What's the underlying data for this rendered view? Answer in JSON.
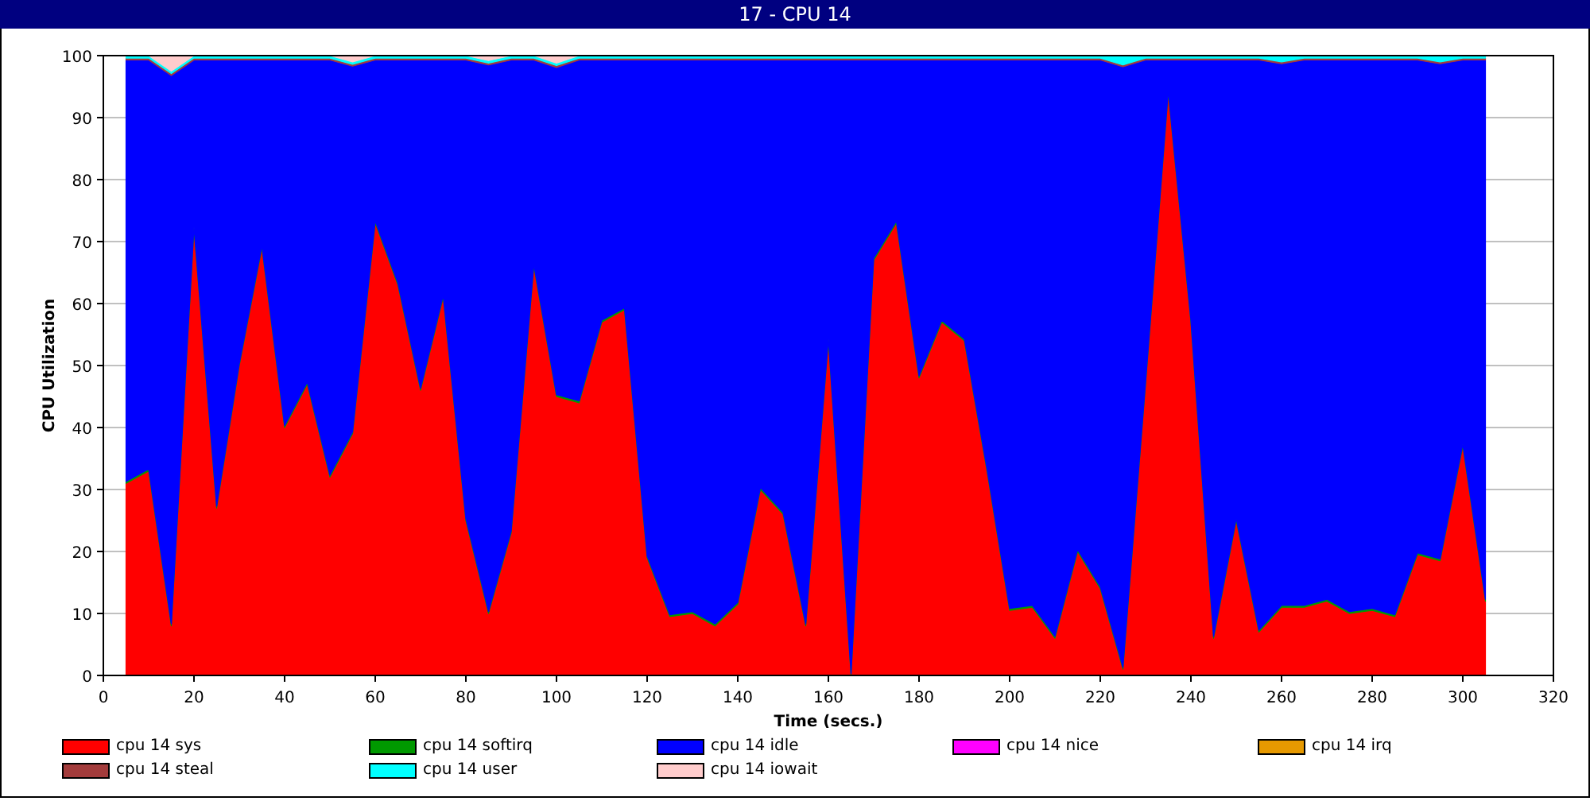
{
  "window": {
    "title": "17 - CPU 14"
  },
  "chart": {
    "chart_data": {
      "type": "area",
      "stacked": true,
      "grid": true,
      "xlabel": "Time (secs.)",
      "ylabel": "CPU Utilization",
      "xlim": [
        0,
        320
      ],
      "ylim": [
        0,
        100
      ],
      "xticks": [
        0,
        20,
        40,
        60,
        80,
        100,
        120,
        140,
        160,
        180,
        200,
        220,
        240,
        260,
        280,
        300,
        320
      ],
      "yticks": [
        0,
        10,
        20,
        30,
        40,
        50,
        60,
        70,
        80,
        90,
        100
      ],
      "x": [
        5,
        10,
        15,
        20,
        25,
        30,
        35,
        40,
        45,
        50,
        55,
        60,
        65,
        70,
        75,
        80,
        85,
        90,
        95,
        100,
        105,
        110,
        115,
        120,
        125,
        130,
        135,
        140,
        145,
        150,
        155,
        160,
        165,
        170,
        175,
        180,
        185,
        190,
        195,
        200,
        205,
        210,
        215,
        220,
        225,
        230,
        235,
        240,
        245,
        250,
        255,
        260,
        265,
        270,
        275,
        280,
        285,
        290,
        295,
        300,
        305
      ],
      "series": [
        {
          "name": "cpu 14 sys",
          "color": "#ff0000",
          "values": [
            31,
            33,
            8,
            72,
            27,
            50,
            69,
            40,
            47,
            32,
            39,
            73,
            63,
            46,
            61,
            25,
            10,
            23,
            66,
            45,
            44,
            57,
            59,
            19,
            9.5,
            10,
            8,
            11.5,
            30,
            26,
            8,
            54,
            0,
            67,
            73,
            48,
            57,
            54,
            33,
            10.5,
            11,
            6,
            20,
            14,
            1,
            47,
            94,
            57,
            6,
            25,
            7,
            11,
            11,
            12,
            10,
            10.5,
            9.5,
            19.5,
            18.5,
            37,
            12
          ]
        },
        {
          "name": "cpu 14 softirq",
          "color": "#009900",
          "values": [
            0.3,
            0.3,
            0.3,
            0.3,
            0.3,
            0.3,
            0.3,
            0.3,
            0.3,
            0.3,
            0.3,
            0.3,
            0.3,
            0.3,
            0.3,
            0.3,
            0.3,
            0.3,
            0.3,
            0.3,
            0.3,
            0.3,
            0.3,
            0.3,
            0.3,
            0.3,
            0.3,
            0.3,
            0.3,
            0.3,
            0.3,
            0.3,
            0.3,
            0.3,
            0.3,
            0.3,
            0.3,
            0.3,
            0.3,
            0.3,
            0.3,
            0.3,
            0.3,
            0.3,
            0.3,
            0.3,
            0.3,
            0.3,
            0.3,
            0.3,
            0.3,
            0.3,
            0.3,
            0.3,
            0.3,
            0.3,
            0.3,
            0.3,
            0.3,
            0.3,
            0.3
          ]
        },
        {
          "name": "cpu 14 idle",
          "color": "#0000ff",
          "values": [
            68,
            66,
            88.5,
            27,
            72,
            49,
            30,
            59,
            52,
            67,
            59,
            26,
            36,
            53,
            38,
            74,
            88.2,
            76,
            33,
            52.8,
            55,
            42,
            40,
            80,
            89.5,
            89,
            91,
            87.5,
            69,
            73,
            91,
            45,
            99,
            32,
            26,
            51,
            42,
            45,
            66,
            88.5,
            88,
            93,
            79,
            85,
            96.9,
            52,
            5,
            42,
            93,
            74,
            92,
            87.4,
            88,
            87,
            89,
            88.5,
            89.5,
            79.5,
            79.9,
            62,
            87
          ]
        },
        {
          "name": "cpu 14 nice",
          "color": "#ff00ff",
          "values": [
            null,
            null,
            null,
            null,
            null,
            null,
            null,
            null,
            null,
            null,
            null,
            null,
            null,
            null,
            null,
            null,
            null,
            null,
            null,
            null,
            null,
            null,
            null,
            null,
            null,
            null,
            null,
            null,
            null,
            null,
            null,
            null,
            null,
            null,
            null,
            null,
            null,
            null,
            null,
            null,
            null,
            null,
            null,
            null,
            null,
            null,
            null,
            null,
            null,
            null,
            null,
            null,
            null,
            null,
            null,
            null,
            null,
            null,
            null,
            null,
            null
          ]
        },
        {
          "name": "cpu 14 irq",
          "color": "#e69900",
          "values": [
            null,
            null,
            null,
            null,
            null,
            null,
            null,
            null,
            null,
            null,
            null,
            null,
            null,
            null,
            null,
            null,
            null,
            null,
            null,
            null,
            null,
            null,
            null,
            null,
            null,
            null,
            null,
            null,
            null,
            null,
            null,
            null,
            null,
            null,
            null,
            null,
            null,
            null,
            null,
            null,
            null,
            null,
            null,
            null,
            null,
            null,
            null,
            null,
            null,
            null,
            null,
            null,
            null,
            null,
            null,
            null,
            null,
            null,
            null,
            null,
            null
          ]
        },
        {
          "name": "cpu 14 steal",
          "color": "#a33c3c",
          "values": [
            0.3,
            0.3,
            0.3,
            0.3,
            0.3,
            0.3,
            0.3,
            0.3,
            0.3,
            0.3,
            0.3,
            0.3,
            0.3,
            0.3,
            0.3,
            0.3,
            0.3,
            0.3,
            0.3,
            0.3,
            0.3,
            0.3,
            0.3,
            0.3,
            0.3,
            0.3,
            0.3,
            0.3,
            0.3,
            0.3,
            0.3,
            0.3,
            0.3,
            0.3,
            0.3,
            0.3,
            0.3,
            0.3,
            0.3,
            0.3,
            0.3,
            0.3,
            0.3,
            0.3,
            0.3,
            0.3,
            0.3,
            0.3,
            0.3,
            0.3,
            0.3,
            0.3,
            0.3,
            0.3,
            0.3,
            0.3,
            0.3,
            0.3,
            0.3,
            0.3,
            0.3
          ]
        },
        {
          "name": "cpu 14 user",
          "color": "#00ffff",
          "values": [
            0.4,
            0.4,
            0.4,
            0.4,
            0.4,
            0.4,
            0.4,
            0.4,
            0.4,
            0.4,
            0.4,
            0.4,
            0.4,
            0.4,
            0.4,
            0.4,
            0.4,
            0.4,
            0.4,
            0.4,
            0.4,
            0.4,
            0.4,
            0.4,
            0.4,
            0.4,
            0.4,
            0.4,
            0.4,
            0.4,
            0.4,
            0.4,
            0.4,
            0.4,
            0.4,
            0.4,
            0.4,
            0.4,
            0.4,
            0.4,
            0.4,
            0.4,
            0.4,
            0.4,
            1.5,
            0.4,
            0.4,
            0.4,
            0.4,
            0.4,
            0.4,
            1,
            0.4,
            0.4,
            0.4,
            0.4,
            0.4,
            0.4,
            1,
            0.4,
            0.4
          ]
        },
        {
          "name": "cpu 14 iowait",
          "color": "#ffcccc",
          "values": [
            0,
            0,
            2.5,
            0,
            0,
            0,
            0,
            0,
            0,
            0,
            1,
            0,
            0,
            0,
            0,
            0,
            0.8,
            0,
            0,
            1.2,
            0,
            0,
            0,
            0,
            0,
            0,
            0,
            0,
            0,
            0,
            0,
            0,
            0,
            0,
            0,
            0,
            0,
            0,
            0,
            0,
            0,
            0,
            0,
            0,
            0,
            0,
            0,
            0,
            0,
            0,
            0,
            0,
            0,
            0,
            0,
            0,
            0,
            0,
            0,
            0,
            0
          ]
        }
      ]
    }
  }
}
